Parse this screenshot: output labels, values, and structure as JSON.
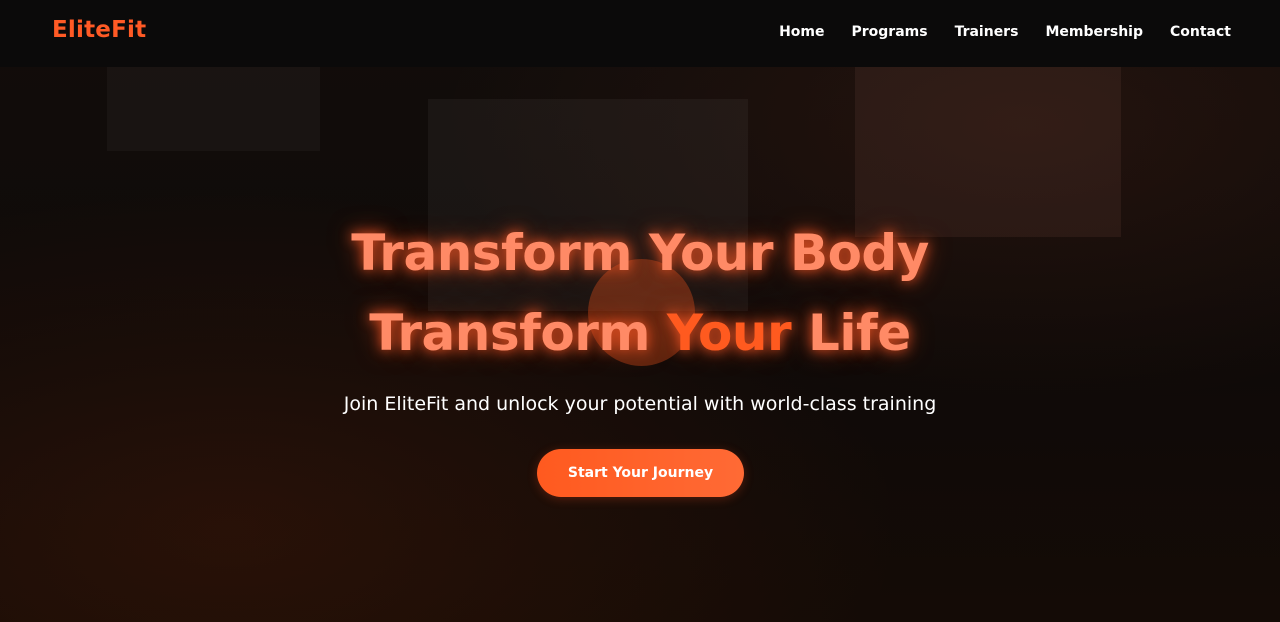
{
  "brand": {
    "name": "EliteFit",
    "color": "#ff5a25"
  },
  "nav": {
    "items": [
      {
        "label": "Home"
      },
      {
        "label": "Programs"
      },
      {
        "label": "Trainers"
      },
      {
        "label": "Membership"
      },
      {
        "label": "Contact"
      }
    ]
  },
  "hero": {
    "headline_line1": "Transform Your Body",
    "headline_line2_start": "Transform ",
    "headline_line2_accent": "Your",
    "headline_line2_end": " Life",
    "subtitle": "Join EliteFit and unlock your potential with world-class training",
    "cta_label": "Start Your Journey"
  },
  "colors": {
    "accent": "#ff5a1f",
    "headline": "#ff8a66",
    "background": "#0d0a09",
    "nav_background": "#0b0a0a"
  }
}
